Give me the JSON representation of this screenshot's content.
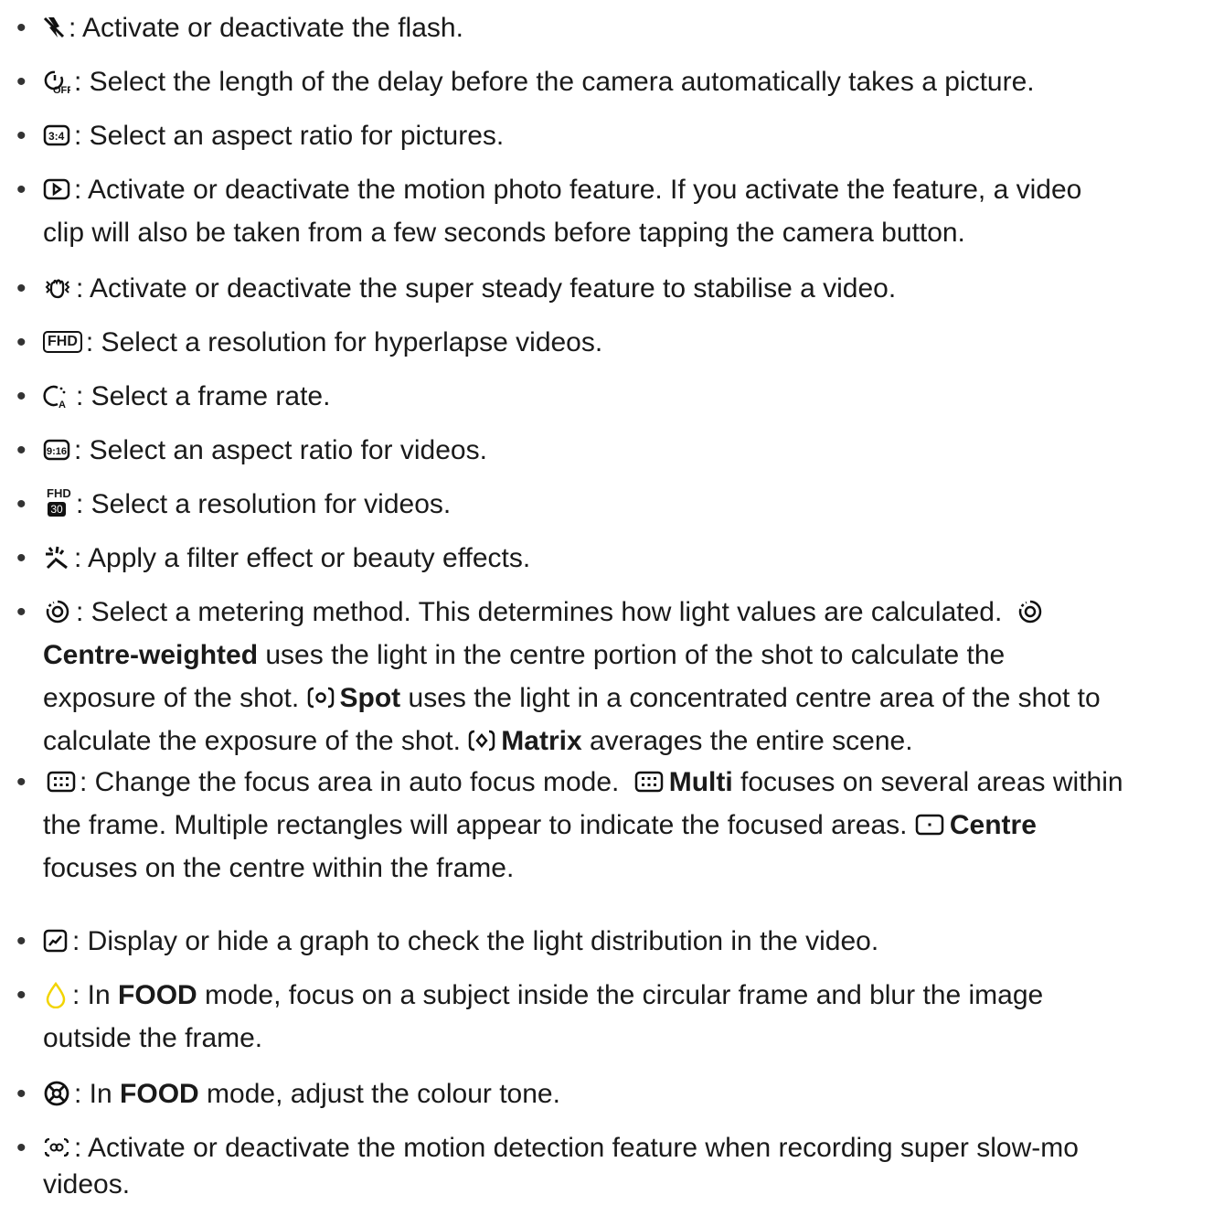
{
  "items": [
    {
      "text": ": Activate or deactivate the flash."
    },
    {
      "text": ": Select the length of the delay before the camera automatically takes a picture."
    },
    {
      "text": ": Select an aspect ratio for pictures."
    },
    {
      "lines": [
        ": Activate or deactivate the motion photo feature. If you activate the feature, a video",
        "clip will also be taken from a few seconds before tapping the camera button."
      ]
    },
    {
      "text": ": Activate or deactivate the super steady feature to stabilise a video."
    },
    {
      "text": ": Select a resolution for hyperlapse videos.",
      "badge": "FHD"
    },
    {
      "text": ": Select a frame rate."
    },
    {
      "text": ": Select an aspect ratio for videos."
    },
    {
      "text": ": Select a resolution for videos.",
      "badge_top": "FHD",
      "badge_bottom": "30"
    },
    {
      "text": ": Apply a filter effect or beauty effects."
    },
    {
      "l1": ": Select a metering method. This determines how light values are calculated.",
      "l2_bold": "Centre-weighted",
      "l2": " uses the light in the centre portion of the shot to calculate the",
      "l3a": "exposure of the shot. ",
      "l3_bold": "Spot",
      "l3b": " uses the light in a concentrated centre area of the shot to",
      "l4a": "calculate the exposure of the shot. ",
      "l4_bold": "Matrix",
      "l4b": " averages the entire scene."
    },
    {
      "l1a": ": Change the focus area in auto focus mode. ",
      "l1_bold": "Multi",
      "l1b": " focuses on several areas within",
      "l2a": "the frame. Multiple rectangles will appear to indicate the focused areas. ",
      "l2_bold": "Centre",
      "l3": "focuses on the centre within the frame."
    },
    {
      "text": ": Display or hide a graph to check the light distribution in the video."
    },
    {
      "l1a": ": In ",
      "l1_bold": "FOOD",
      "l1b": " mode, focus on a subject inside the circular frame and blur the image",
      "l2": "outside the frame."
    },
    {
      "l1a": ": In ",
      "l1_bold": "FOOD",
      "l1b": " mode, adjust the colour tone."
    },
    {
      "lines": [
        ": Activate or deactivate the motion detection feature when recording super slow-mo",
        "videos."
      ]
    }
  ],
  "bullet": "•",
  "colors": {
    "text": "#1a1a1a",
    "food_icon": "#f2d400"
  }
}
